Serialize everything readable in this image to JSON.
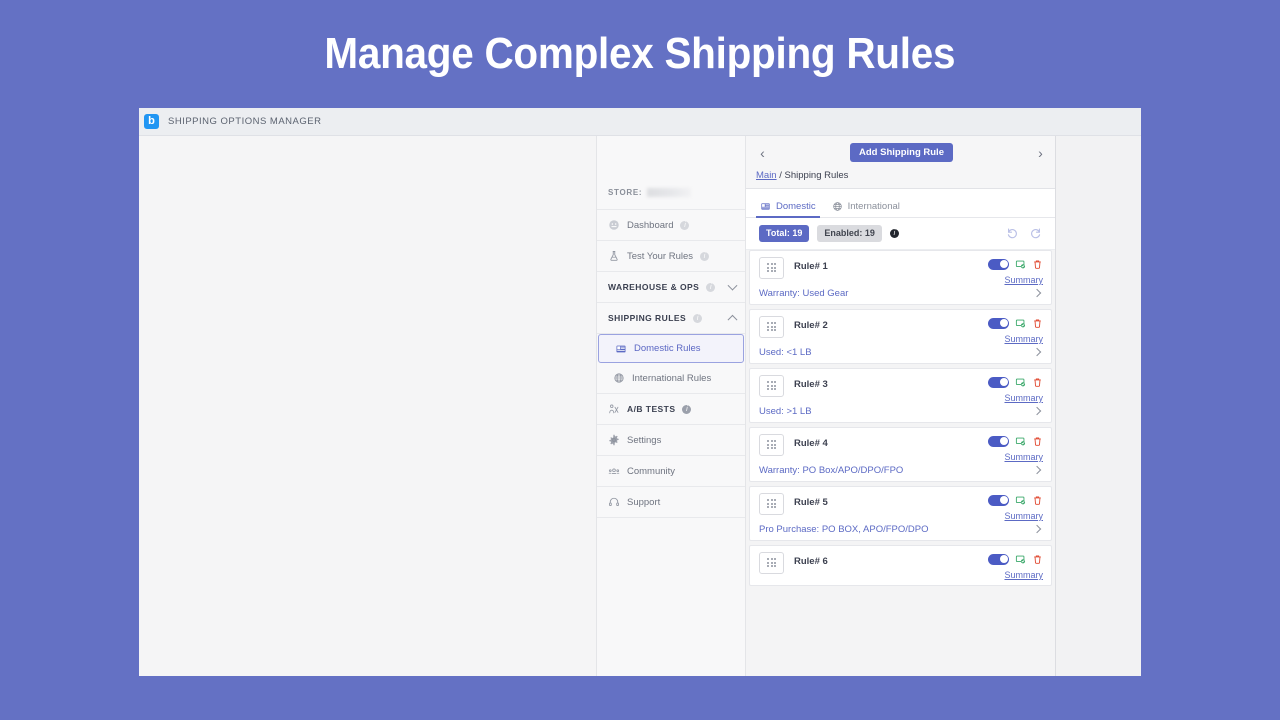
{
  "banner": {
    "title": "Manage Complex Shipping Rules",
    "background_color": "#6471c4",
    "text_color": "#ffffff"
  },
  "app_header": {
    "logo_letter": "b",
    "logo_color": "#2196f3",
    "title": "SHIPPING OPTIONS MANAGER"
  },
  "sidebar": {
    "store_label": "STORE:",
    "store_value": "",
    "items": [
      {
        "label": "Dashboard",
        "icon": "dashboard-icon",
        "has_info": true,
        "type": "item"
      },
      {
        "label": "Test Your Rules",
        "icon": "flask-icon",
        "has_info": true,
        "type": "item"
      },
      {
        "label": "WAREHOUSE & OPS",
        "icon": "",
        "has_info": true,
        "type": "section",
        "chevron": "down"
      },
      {
        "label": "SHIPPING RULES",
        "icon": "",
        "has_info": true,
        "type": "section",
        "chevron": "up"
      },
      {
        "label": "Domestic Rules",
        "icon": "flag-icon",
        "has_info": false,
        "type": "child",
        "selected": true
      },
      {
        "label": "International Rules",
        "icon": "globe-icon",
        "has_info": false,
        "type": "child",
        "selected": false
      },
      {
        "label": "A/B TESTS",
        "icon": "ab-test-icon",
        "has_info": true,
        "type": "section-bold"
      },
      {
        "label": "Settings",
        "icon": "gear-icon",
        "has_info": false,
        "type": "item"
      },
      {
        "label": "Community",
        "icon": "community-icon",
        "has_info": false,
        "type": "item"
      },
      {
        "label": "Support",
        "icon": "headset-icon",
        "has_info": false,
        "type": "item"
      }
    ]
  },
  "rules_panel": {
    "prev_arrow": "‹",
    "next_arrow": "›",
    "add_button_label": "Add Shipping Rule",
    "add_button_color": "#5c6ac4",
    "breadcrumb": {
      "root": "Main",
      "separator": " / ",
      "current": "Shipping Rules"
    },
    "tabs": [
      {
        "label": "Domestic",
        "icon": "flag-icon",
        "active": true
      },
      {
        "label": "International",
        "icon": "globe-icon",
        "active": false
      }
    ],
    "counts": {
      "total_label": "Total: 19",
      "enabled_label": "Enabled: 19",
      "info_icon": "info-icon"
    },
    "history": {
      "undo_icon": "undo-icon",
      "redo_icon": "redo-icon"
    },
    "summary_label": "Summary",
    "rules": [
      {
        "name": "Rule# 1",
        "description": "Warranty: Used Gear",
        "enabled": true
      },
      {
        "name": "Rule# 2",
        "description": "Used: <1 LB",
        "enabled": true
      },
      {
        "name": "Rule# 3",
        "description": "Used: >1 LB",
        "enabled": true
      },
      {
        "name": "Rule# 4",
        "description": "Warranty: PO Box/APO/DPO/FPO",
        "enabled": true
      },
      {
        "name": "Rule# 5",
        "description": "Pro Purchase: PO BOX, APO/FPO/DPO",
        "enabled": true
      },
      {
        "name": "Rule# 6",
        "description": "",
        "enabled": true
      }
    ]
  }
}
